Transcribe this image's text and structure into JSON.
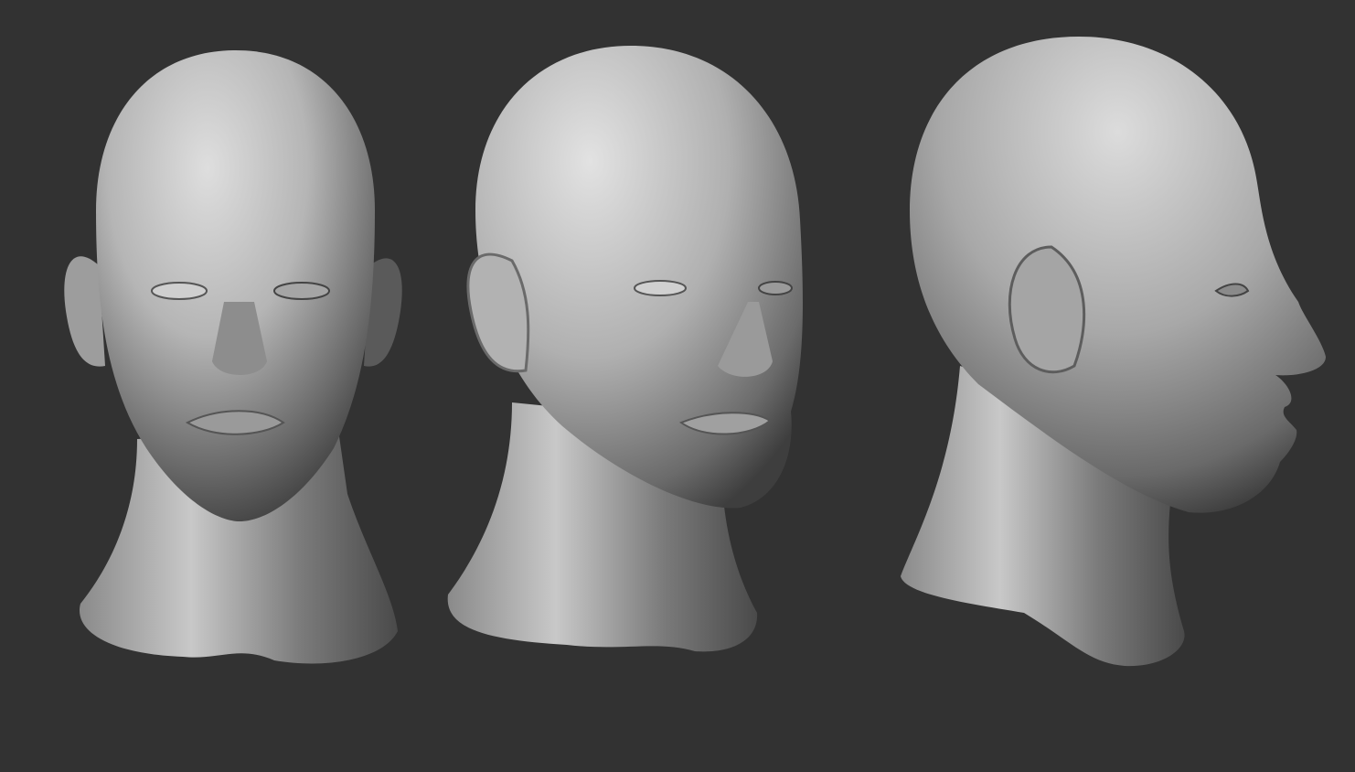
{
  "scene": {
    "background_color": "#323232",
    "material_highlight": "#d9d9d9",
    "material_mid": "#9a9a9a",
    "material_shadow": "#3a3a3a"
  },
  "views": [
    {
      "id": "front"
    },
    {
      "id": "three-quarter"
    },
    {
      "id": "profile"
    }
  ]
}
